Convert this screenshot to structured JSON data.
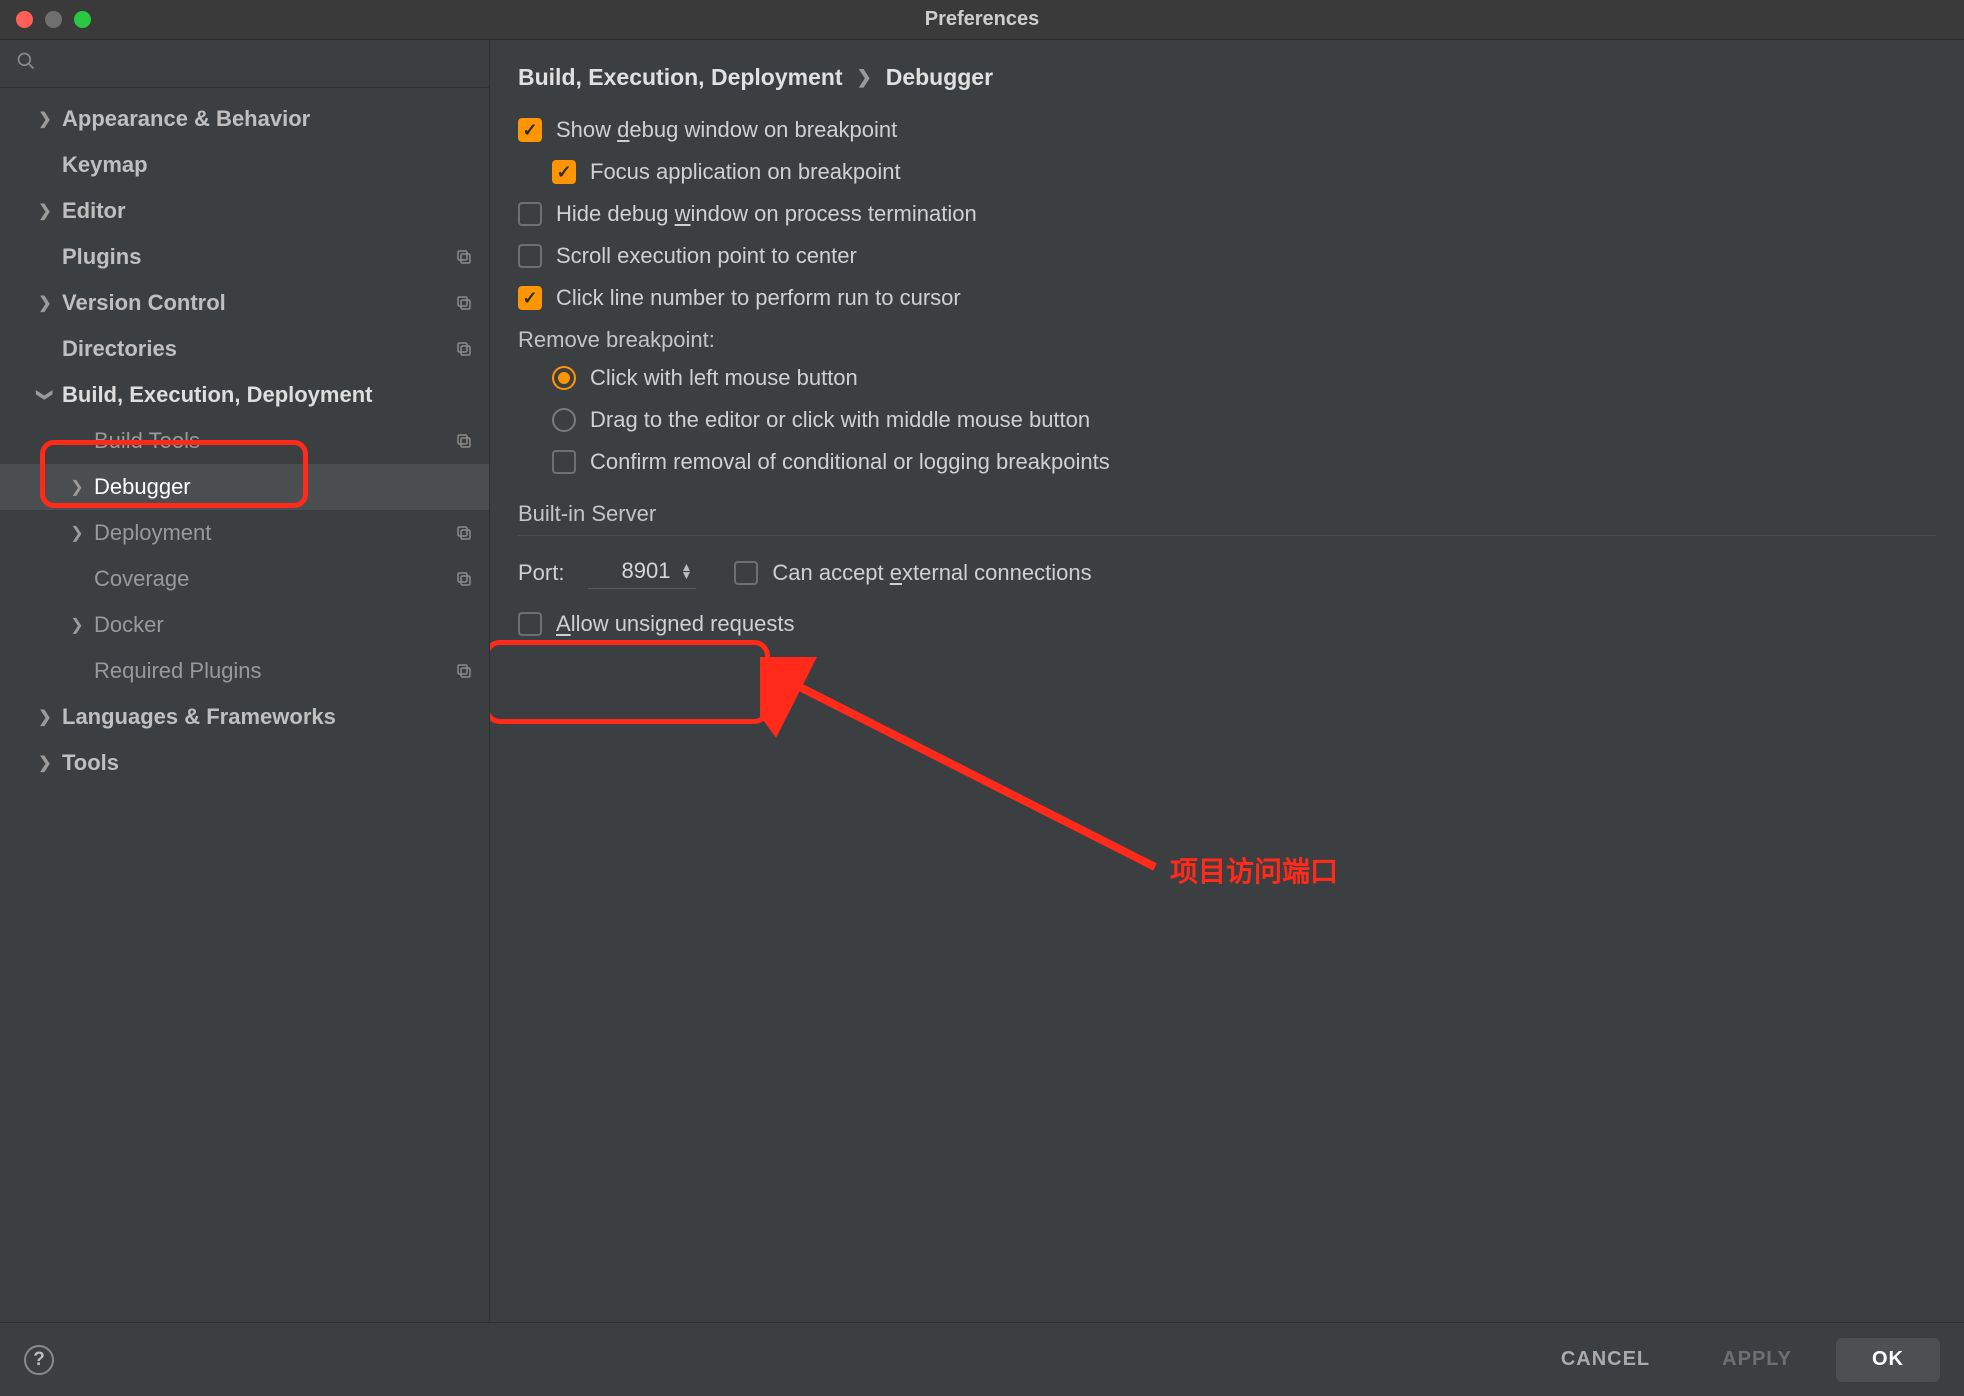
{
  "window": {
    "title": "Preferences"
  },
  "sidebar": {
    "items": [
      {
        "label": "Appearance & Behavior",
        "chev": true,
        "strong": true
      },
      {
        "label": "Keymap",
        "chev": false,
        "strong": true
      },
      {
        "label": "Editor",
        "chev": true,
        "strong": true
      },
      {
        "label": "Plugins",
        "chev": false,
        "strong": true,
        "copy": true
      },
      {
        "label": "Version Control",
        "chev": true,
        "strong": true,
        "copy": true
      },
      {
        "label": "Directories",
        "chev": false,
        "strong": true,
        "copy": true
      },
      {
        "label": "Build, Execution, Deployment",
        "chev": true,
        "bright": true,
        "expanded": true
      },
      {
        "label": "Build Tools",
        "chev": false,
        "indent": 1,
        "copy": true
      },
      {
        "label": "Debugger",
        "chev": true,
        "indent": 1,
        "selected": true
      },
      {
        "label": "Deployment",
        "chev": true,
        "indent": 1,
        "copy": true
      },
      {
        "label": "Coverage",
        "chev": false,
        "indent": 1,
        "copy": true
      },
      {
        "label": "Docker",
        "chev": true,
        "indent": 1
      },
      {
        "label": "Required Plugins",
        "chev": false,
        "indent": 1,
        "copy": true
      },
      {
        "label": "Languages & Frameworks",
        "chev": true,
        "strong": true
      },
      {
        "label": "Tools",
        "chev": true,
        "strong": true
      }
    ]
  },
  "breadcrumb": {
    "root": "Build, Execution, Deployment",
    "leaf": "Debugger"
  },
  "options": {
    "show_debug_window": "Show debug window on breakpoint",
    "focus_app": "Focus application on breakpoint",
    "hide_on_term": "Hide debug window on process termination",
    "scroll_center": "Scroll execution point to center",
    "click_line_run": "Click line number to perform run to cursor",
    "remove_bp_label": "Remove breakpoint:",
    "rb_left_click": "Click with left mouse button",
    "rb_drag": "Drag to the editor or click with middle mouse button",
    "confirm_removal": "Confirm removal of conditional or logging breakpoints"
  },
  "server": {
    "title": "Built-in Server",
    "port_label": "Port:",
    "port_value": "8901",
    "accept_ext": "Can accept external connections",
    "allow_unsigned": "Allow unsigned requests"
  },
  "annotation": {
    "text": "项目访问端口"
  },
  "footer": {
    "cancel": "CANCEL",
    "apply": "APPLY",
    "ok": "OK"
  },
  "underlines": {
    "d": "d",
    "w": "w",
    "e": "e",
    "A": "A"
  }
}
